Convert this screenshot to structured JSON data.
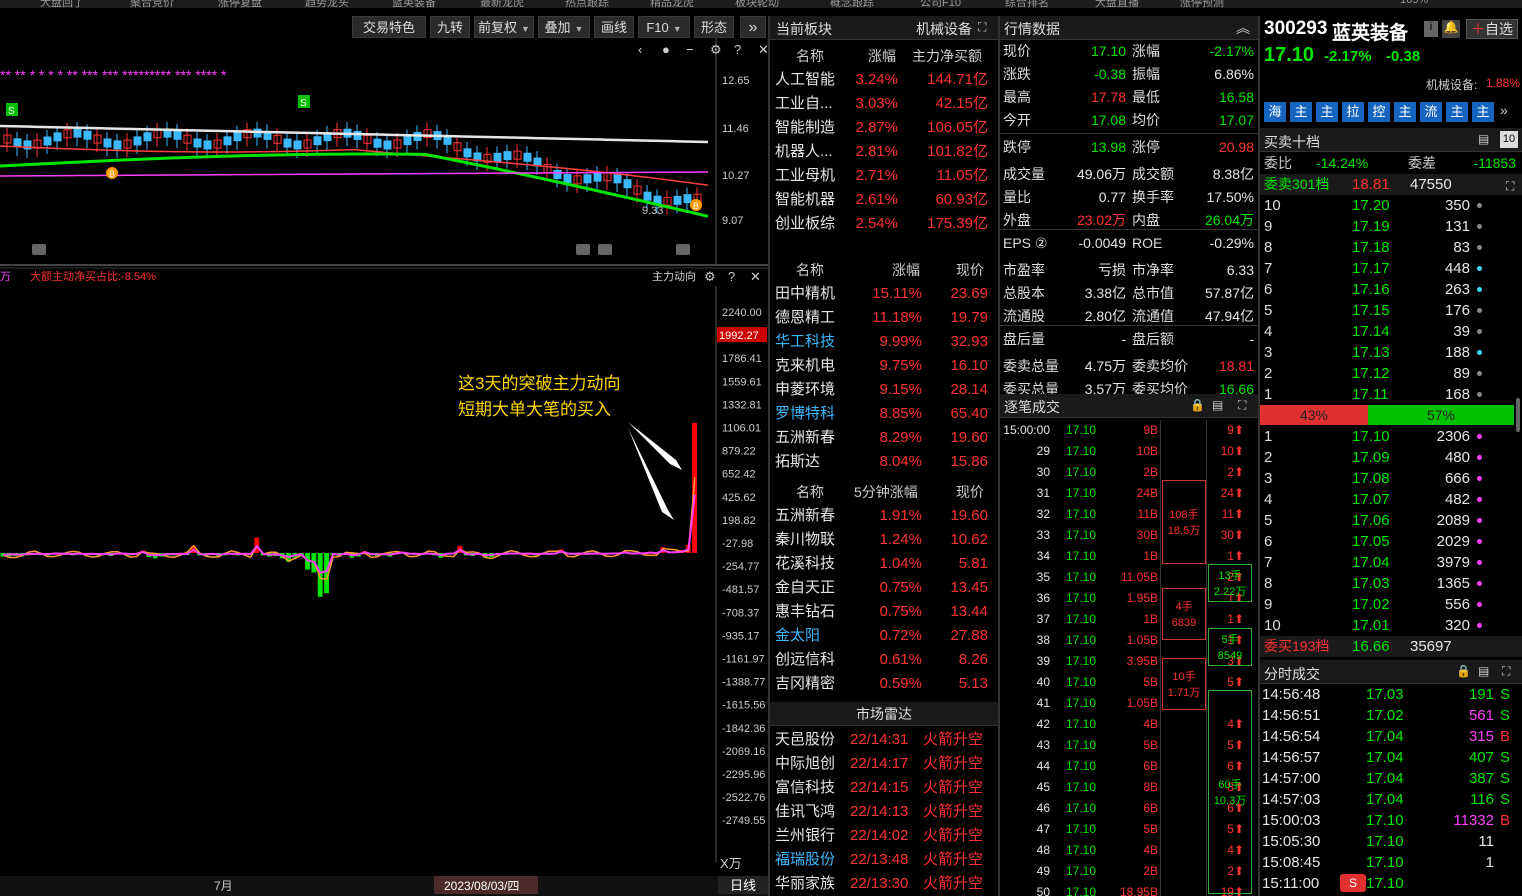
{
  "top_tabs": [
    "大盘回了",
    "聚合竞价",
    "涨停复盘",
    "趋势龙头",
    "蓝英装备",
    "最新龙虎",
    "热点跟踪",
    "精品龙虎",
    "板块轮动",
    "概念跟踪",
    "公司F10",
    "综合排名",
    "大盘直播",
    "涨停预测",
    "165%"
  ],
  "toolbar": {
    "items": [
      "交易特色",
      "九转",
      "前复权",
      "叠加",
      "画线",
      "F10",
      "形态"
    ],
    "more": "»"
  },
  "kchart": {
    "y_labels": [
      "12.65",
      "11.46",
      "10.27",
      "9.07"
    ],
    "low_label": "9.33",
    "signal_s": "S",
    "signal_b": "B",
    "stars": "**  **            *    *    *    *          **          ***    ***   *********    ***    ****   *"
  },
  "mf": {
    "legend_left": "万",
    "legend_main": "大额主动净买占比:-8.54%",
    "indicator": "主力动向",
    "y_labels": [
      "2240.00",
      "1992.27",
      "1786.41",
      "1559.61",
      "1332.81",
      "1106.01",
      "879.22",
      "652.42",
      "425.62",
      "198.82",
      "-27.98",
      "-254.77",
      "-481.57",
      "-708.37",
      "-935.17",
      "-1161.97",
      "-1388.77",
      "-1615.56",
      "-1842.36",
      "-2069.16",
      "-2295.96",
      "-2522.76",
      "-2749.55"
    ],
    "unit": "X万",
    "annotation_line1": "这3天的突破主力动向",
    "annotation_line2": "短期大单大笔的买入",
    "x_label": "7月",
    "date": "2023/08/03/四",
    "period": "日线",
    "bars": [
      -30,
      -28,
      -25,
      -30,
      -20,
      -15,
      -18,
      -22,
      -10,
      -12,
      -15,
      -20,
      -12,
      -18,
      -15,
      -20,
      -18,
      -25,
      -12,
      -10,
      -20,
      -15,
      20,
      -35,
      -45,
      -30,
      -20,
      -20,
      -15,
      -18,
      60,
      -20,
      -25,
      -15,
      -30,
      -20,
      -12,
      -20,
      -15,
      -18,
      130,
      -20,
      -30,
      -25,
      -45,
      -75,
      -40,
      -25,
      -140,
      -165,
      -370,
      -340,
      -20,
      -30,
      -15,
      -40,
      -30,
      15,
      -20,
      -25,
      -20,
      -30,
      -10,
      10,
      -12,
      -15,
      -18,
      -10,
      -20,
      -40,
      -12,
      -10,
      60,
      -20,
      -25,
      -15,
      -40,
      -35,
      -20,
      -15,
      -10,
      -10,
      -15,
      -10,
      -20,
      -12,
      -15,
      -10,
      30,
      -12,
      -15,
      -10,
      -15,
      -10,
      -12,
      -15,
      -10,
      -8,
      10,
      -10,
      -5,
      -8,
      10,
      -5,
      50,
      12,
      15,
      25,
      70,
      1100
    ]
  },
  "sector_current": {
    "title": "当前板块",
    "sector": "机械设备",
    "cols": [
      "名称",
      "涨幅",
      "主力净买额"
    ],
    "rows": [
      [
        "人工智能",
        "3.24%",
        "144.71亿"
      ],
      [
        "工业自...",
        "3.03%",
        "42.15亿"
      ],
      [
        "智能制造",
        "2.87%",
        "106.05亿"
      ],
      [
        "机器人...",
        "2.81%",
        "101.82亿"
      ],
      [
        "工业母机",
        "2.71%",
        "11.05亿"
      ],
      [
        "智能机器",
        "2.61%",
        "60.93亿"
      ],
      [
        "创业板综",
        "2.54%",
        "175.39亿"
      ]
    ]
  },
  "gainers": {
    "cols": [
      "名称",
      "涨幅",
      "现价"
    ],
    "rows": [
      [
        "田中精机",
        "15.11%",
        "23.69"
      ],
      [
        "德恩精工",
        "11.18%",
        "19.79"
      ],
      [
        "华工科技",
        "9.99%",
        "32.93"
      ],
      [
        "克来机电",
        "9.75%",
        "16.10"
      ],
      [
        "申菱环境",
        "9.15%",
        "28.14"
      ],
      [
        "罗博特科",
        "8.85%",
        "65.40"
      ],
      [
        "五洲新春",
        "8.29%",
        "19.60"
      ],
      [
        "拓斯达",
        "8.04%",
        "15.86"
      ]
    ]
  },
  "fivemin": {
    "cols": [
      "名称",
      "5分钟涨幅",
      "现价"
    ],
    "rows": [
      [
        "五洲新春",
        "1.91%",
        "19.60"
      ],
      [
        "秦川物联",
        "1.24%",
        "10.62"
      ],
      [
        "花溪科技",
        "1.04%",
        "5.81"
      ],
      [
        "金自天正",
        "0.75%",
        "13.45"
      ],
      [
        "惠丰钻石",
        "0.75%",
        "13.44"
      ],
      [
        "金太阳",
        "0.72%",
        "27.88"
      ],
      [
        "创远信科",
        "0.61%",
        "8.26"
      ],
      [
        "吉冈精密",
        "0.59%",
        "5.13"
      ]
    ]
  },
  "radar": {
    "title": "市场雷达",
    "rows": [
      [
        "天邑股份",
        "22/14:31",
        "火箭升空"
      ],
      [
        "中际旭创",
        "22/14:17",
        "火箭升空"
      ],
      [
        "富信科技",
        "22/14:15",
        "火箭升空"
      ],
      [
        "佳讯飞鸿",
        "22/14:13",
        "火箭升空"
      ],
      [
        "兰州银行",
        "22/14:02",
        "火箭升空"
      ],
      [
        "福瑞股份",
        "22/13:48",
        "火箭升空"
      ],
      [
        "华丽家族",
        "22/13:30",
        "火箭升空"
      ]
    ]
  },
  "quote": {
    "title": "行情数据",
    "rows": [
      [
        "现价",
        "17.10",
        "涨幅",
        "-2.17%"
      ],
      [
        "涨跌",
        "-0.38",
        "振幅",
        "6.86%"
      ],
      [
        "最高",
        "17.78",
        "最低",
        "16.58"
      ],
      [
        "今开",
        "17.08",
        "均价",
        "17.07"
      ],
      [
        "跌停",
        "13.98",
        "涨停",
        "20.98"
      ],
      [
        "成交量",
        "49.06万",
        "成交额",
        "8.38亿"
      ],
      [
        "量比",
        "0.77",
        "换手率",
        "17.50%"
      ],
      [
        "外盘",
        "23.02万",
        "内盘",
        "26.04万"
      ],
      [
        "EPS ②",
        "-0.0049",
        "ROE",
        "-0.29%"
      ],
      [
        "市盈率",
        "亏损",
        "市净率",
        "6.33"
      ],
      [
        "总股本",
        "3.38亿",
        "总市值",
        "57.87亿"
      ],
      [
        "流通股",
        "2.80亿",
        "流通值",
        "47.94亿"
      ],
      [
        "盘后量",
        "-",
        "盘后额",
        "-"
      ],
      [
        "委卖总量",
        "4.75万",
        "委卖均价",
        "18.81"
      ],
      [
        "委买总量",
        "3.57万",
        "委买均价",
        "16.66"
      ]
    ]
  },
  "ticks": {
    "title": "逐笔成交",
    "rows": [
      [
        "15:00:00",
        "17.10",
        "9B",
        "9"
      ],
      [
        "29",
        "17.10",
        "10B",
        "10"
      ],
      [
        "30",
        "17.10",
        "2B",
        "2"
      ],
      [
        "31",
        "17.10",
        "24B",
        "24"
      ],
      [
        "32",
        "17.10",
        "11B",
        "11"
      ],
      [
        "33",
        "17.10",
        "30B",
        "30"
      ],
      [
        "34",
        "17.10",
        "1B",
        "1"
      ],
      [
        "35",
        "17.10",
        "11.05B",
        "2"
      ],
      [
        "36",
        "17.10",
        "1.95B",
        "1"
      ],
      [
        "37",
        "17.10",
        "1B",
        "1"
      ],
      [
        "38",
        "17.10",
        "1.05B",
        "1"
      ],
      [
        "39",
        "17.10",
        "3.95B",
        "3"
      ],
      [
        "40",
        "17.10",
        "5B",
        "5"
      ],
      [
        "41",
        "17.10",
        "1.05B",
        ""
      ],
      [
        "42",
        "17.10",
        "4B",
        "4"
      ],
      [
        "43",
        "17.10",
        "5B",
        "5"
      ],
      [
        "44",
        "17.10",
        "6B",
        "6"
      ],
      [
        "45",
        "17.10",
        "8B",
        "8"
      ],
      [
        "46",
        "17.10",
        "6B",
        "6"
      ],
      [
        "47",
        "17.10",
        "5B",
        "5"
      ],
      [
        "48",
        "17.10",
        "4B",
        "4"
      ],
      [
        "49",
        "17.10",
        "2B",
        "2"
      ],
      [
        "50",
        "17.10",
        "18.95B",
        "19"
      ]
    ],
    "boxes": [
      [
        "108手",
        "18.5万"
      ],
      [
        "13手",
        "2.22万"
      ],
      [
        "4手",
        "6839"
      ],
      [
        "5手",
        "8549"
      ],
      [
        "10手",
        "1.71万"
      ],
      [
        "60手",
        "10.3万"
      ]
    ]
  },
  "stock": {
    "code": "300293",
    "name": "蓝英装备",
    "price": "17.10",
    "chg_pct": "-2.17%",
    "chg": "-0.38",
    "add_btn": "自选",
    "sector_label": "机械设备:",
    "sector_pct": "1.88%",
    "tags": [
      "海",
      "主",
      "主",
      "拉",
      "控",
      "主",
      "流",
      "主",
      "主"
    ]
  },
  "orderbook": {
    "title": "买卖十档",
    "wb_label": "委比",
    "wb": "-14.24%",
    "wc_label": "委差",
    "wc": "-11853",
    "ask_total_label": "委卖301档",
    "ask_total_price": "18.81",
    "ask_total_vol": "47550",
    "asks": [
      [
        "10",
        "17.20",
        "350"
      ],
      [
        "9",
        "17.19",
        "131"
      ],
      [
        "8",
        "17.18",
        "83"
      ],
      [
        "7",
        "17.17",
        "448"
      ],
      [
        "6",
        "17.16",
        "263"
      ],
      [
        "5",
        "17.15",
        "176"
      ],
      [
        "4",
        "17.14",
        "39"
      ],
      [
        "3",
        "17.13",
        "188"
      ],
      [
        "2",
        "17.12",
        "89"
      ],
      [
        "1",
        "17.11",
        "168"
      ]
    ],
    "ratio_sell": "43%",
    "ratio_buy": "57%",
    "bids": [
      [
        "1",
        "17.10",
        "2306"
      ],
      [
        "2",
        "17.09",
        "480"
      ],
      [
        "3",
        "17.08",
        "666"
      ],
      [
        "4",
        "17.07",
        "482"
      ],
      [
        "5",
        "17.06",
        "2089"
      ],
      [
        "6",
        "17.05",
        "2029"
      ],
      [
        "7",
        "17.04",
        "3979"
      ],
      [
        "8",
        "17.03",
        "1365"
      ],
      [
        "9",
        "17.02",
        "556"
      ],
      [
        "10",
        "17.01",
        "320"
      ]
    ],
    "bid_total_label": "委买193档",
    "bid_total_price": "16.66",
    "bid_total_vol": "35697"
  },
  "minute_trades": {
    "title": "分时成交",
    "rows": [
      [
        "14:56:48",
        "17.03",
        "191",
        "S"
      ],
      [
        "14:56:51",
        "17.02",
        "561",
        "S"
      ],
      [
        "14:56:54",
        "17.04",
        "315",
        "B"
      ],
      [
        "14:56:57",
        "17.04",
        "407",
        "S"
      ],
      [
        "14:57:00",
        "17.04",
        "387",
        "S"
      ],
      [
        "14:57:03",
        "17.04",
        "116",
        "S"
      ],
      [
        "15:00:03",
        "17.10",
        "11332",
        "B"
      ],
      [
        "15:05:30",
        "17.10",
        "11",
        ""
      ],
      [
        "15:08:45",
        "17.10",
        "1",
        ""
      ],
      [
        "15:11:00",
        "17.10",
        "",
        ""
      ]
    ]
  },
  "colors": {
    "up": "#ff3232",
    "down": "#00e600",
    "cyan": "#3cb8ff",
    "magenta": "#ff40ff",
    "yellow": "#ffd700"
  }
}
